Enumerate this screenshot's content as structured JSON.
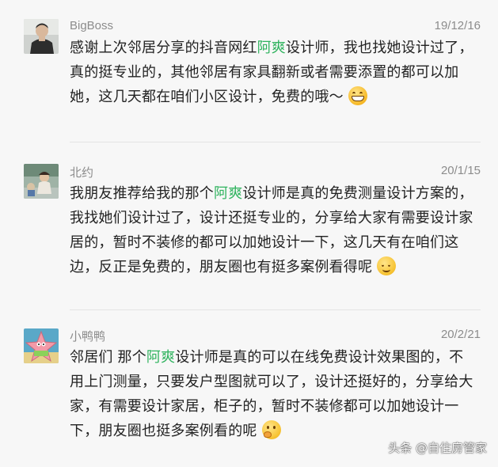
{
  "comments": [
    {
      "name": "BigBoss",
      "date": "19/12/16",
      "text_before": "感谢上次邻居分享的抖音网红",
      "highlight": "阿爽",
      "text_after": "设计师，我也找她设计过了，真的挺专业的，其他邻居有家具翻新或者需要添置的都可以加她，这几天都在咱们小区设计，免费的哦～",
      "emoji": "grinning-face-icon"
    },
    {
      "name": "北约",
      "date": "20/1/15",
      "text_before": "我朋友推荐给我的那个",
      "highlight": "阿爽",
      "text_after": "设计师是真的免费测量设计方案的，我找她们设计过了，设计还挺专业的，分享给大家有需要设计家居的，暂时不装修的都可以加她设计一下，这几天有在咱们这边，反正是免费的，朋友圈也有挺多案例看得呢",
      "emoji": "smiling-face-icon"
    },
    {
      "name": "小鸭鸭",
      "date": "20/2/21",
      "text_before": "邻居们 那个",
      "highlight": "阿爽",
      "text_after": "设计师是真的可以在线免费设计效果图的，不用上门测量，只要发户型图就可以了，设计还挺好的，分享给大家，有需要设计家居，柜子的，暂时不装修都可以加她设计一下，朋友圈也挺多案例看的呢",
      "emoji": "thinking-face-icon"
    }
  ],
  "watermark": "头条 @自住房管家",
  "colors": {
    "highlight": "#2fb35e",
    "meta": "#8c8c8c",
    "text": "#222222",
    "background": "#f7f7f7"
  }
}
